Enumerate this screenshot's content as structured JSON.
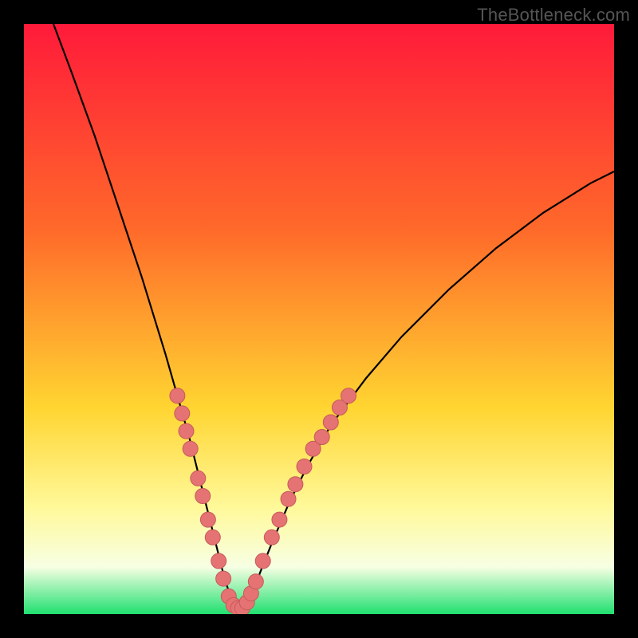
{
  "watermark": "TheBottleneck.com",
  "colors": {
    "frame": "#000000",
    "curve": "#000000",
    "marker_fill": "#e57373",
    "marker_stroke": "#c75a5a",
    "grad_top": "#ff1a3a",
    "grad_mid1": "#ff6a2a",
    "grad_mid2": "#ffd531",
    "grad_mid3": "#fff99a",
    "grad_mid4": "#f7ffe3",
    "grad_bottom": "#20e070"
  },
  "chart_data": {
    "type": "line",
    "title": "",
    "xlabel": "",
    "ylabel": "",
    "xlim": [
      0,
      100
    ],
    "ylim": [
      0,
      100
    ],
    "curve": {
      "x": [
        5,
        8,
        12,
        16,
        20,
        24,
        26,
        28,
        30,
        31,
        32,
        33,
        34,
        35,
        36,
        37,
        38,
        39,
        40,
        42,
        45,
        48,
        52,
        58,
        64,
        72,
        80,
        88,
        96,
        100
      ],
      "y": [
        100,
        92,
        81,
        69,
        57,
        44,
        37,
        30,
        22,
        18,
        14,
        10,
        6,
        3,
        1,
        1,
        2,
        4,
        7,
        12,
        19,
        25,
        32,
        40,
        47,
        55,
        62,
        68,
        73,
        75
      ]
    },
    "markers": [
      {
        "x": 26.0,
        "y": 37
      },
      {
        "x": 26.8,
        "y": 34
      },
      {
        "x": 27.5,
        "y": 31
      },
      {
        "x": 28.2,
        "y": 28
      },
      {
        "x": 29.5,
        "y": 23
      },
      {
        "x": 30.3,
        "y": 20
      },
      {
        "x": 31.2,
        "y": 16
      },
      {
        "x": 32.0,
        "y": 13
      },
      {
        "x": 33.0,
        "y": 9
      },
      {
        "x": 33.8,
        "y": 6
      },
      {
        "x": 34.7,
        "y": 3
      },
      {
        "x": 35.5,
        "y": 1.5
      },
      {
        "x": 36.3,
        "y": 1
      },
      {
        "x": 37.0,
        "y": 1
      },
      {
        "x": 37.8,
        "y": 2
      },
      {
        "x": 38.5,
        "y": 3.5
      },
      {
        "x": 39.3,
        "y": 5.5
      },
      {
        "x": 40.5,
        "y": 9
      },
      {
        "x": 42.0,
        "y": 13
      },
      {
        "x": 43.3,
        "y": 16
      },
      {
        "x": 44.8,
        "y": 19.5
      },
      {
        "x": 46.0,
        "y": 22
      },
      {
        "x": 47.5,
        "y": 25
      },
      {
        "x": 49.0,
        "y": 28
      },
      {
        "x": 50.5,
        "y": 30
      },
      {
        "x": 52.0,
        "y": 32.5
      },
      {
        "x": 53.5,
        "y": 35
      },
      {
        "x": 55.0,
        "y": 37
      }
    ],
    "gradient_stops": [
      {
        "offset": 0.0,
        "colorKey": "grad_top"
      },
      {
        "offset": 0.35,
        "colorKey": "grad_mid1"
      },
      {
        "offset": 0.65,
        "colorKey": "grad_mid2"
      },
      {
        "offset": 0.82,
        "colorKey": "grad_mid3"
      },
      {
        "offset": 0.92,
        "colorKey": "grad_mid4"
      },
      {
        "offset": 1.0,
        "colorKey": "grad_bottom"
      }
    ]
  }
}
